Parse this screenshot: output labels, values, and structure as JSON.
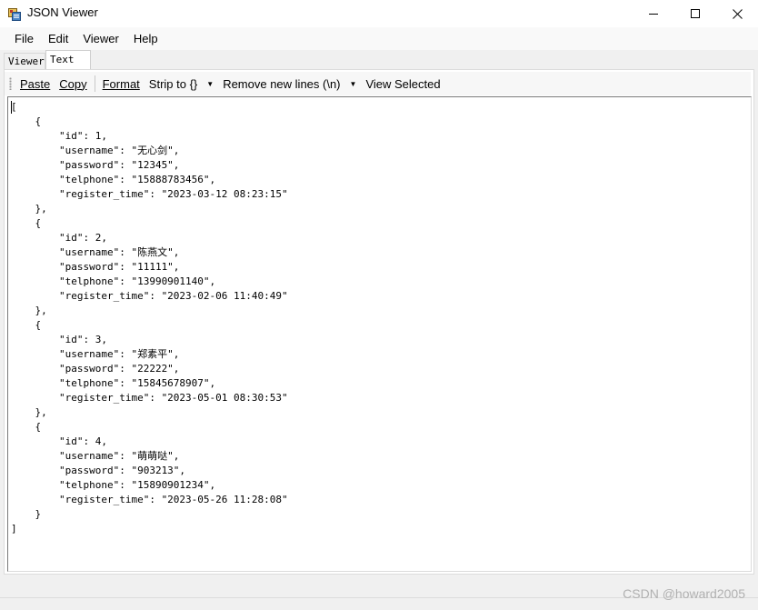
{
  "window": {
    "title": "JSON Viewer"
  },
  "menu": {
    "items": [
      "File",
      "Edit",
      "Viewer",
      "Help"
    ]
  },
  "tabs": {
    "items": [
      "Viewer",
      "Text"
    ],
    "active": "Text"
  },
  "toolbar": {
    "paste": "Paste",
    "copy": "Copy",
    "format": "Format",
    "strip": "Strip to {}",
    "remove_newlines": "Remove new lines (\\n)",
    "view_selected": "View Selected"
  },
  "editor": {
    "text": "[\n    {\n        \"id\": 1,\n        \"username\": \"无心剑\",\n        \"password\": \"12345\",\n        \"telphone\": \"15888783456\",\n        \"register_time\": \"2023-03-12 08:23:15\"\n    },\n    {\n        \"id\": 2,\n        \"username\": \"陈燕文\",\n        \"password\": \"11111\",\n        \"telphone\": \"13990901140\",\n        \"register_time\": \"2023-02-06 11:40:49\"\n    },\n    {\n        \"id\": 3,\n        \"username\": \"郑素平\",\n        \"password\": \"22222\",\n        \"telphone\": \"15845678907\",\n        \"register_time\": \"2023-05-01 08:30:53\"\n    },\n    {\n        \"id\": 4,\n        \"username\": \"萌萌哒\",\n        \"password\": \"903213\",\n        \"telphone\": \"15890901234\",\n        \"register_time\": \"2023-05-26 11:28:08\"\n    }\n]"
  },
  "watermark": "CSDN @howard2005",
  "icons": {
    "app": "json-viewer-app-icon",
    "minimize": "minimize-icon",
    "maximize": "maximize-icon",
    "close": "close-icon",
    "grip": "toolbar-grip-icon",
    "dropdown": "dropdown-arrow-icon"
  }
}
